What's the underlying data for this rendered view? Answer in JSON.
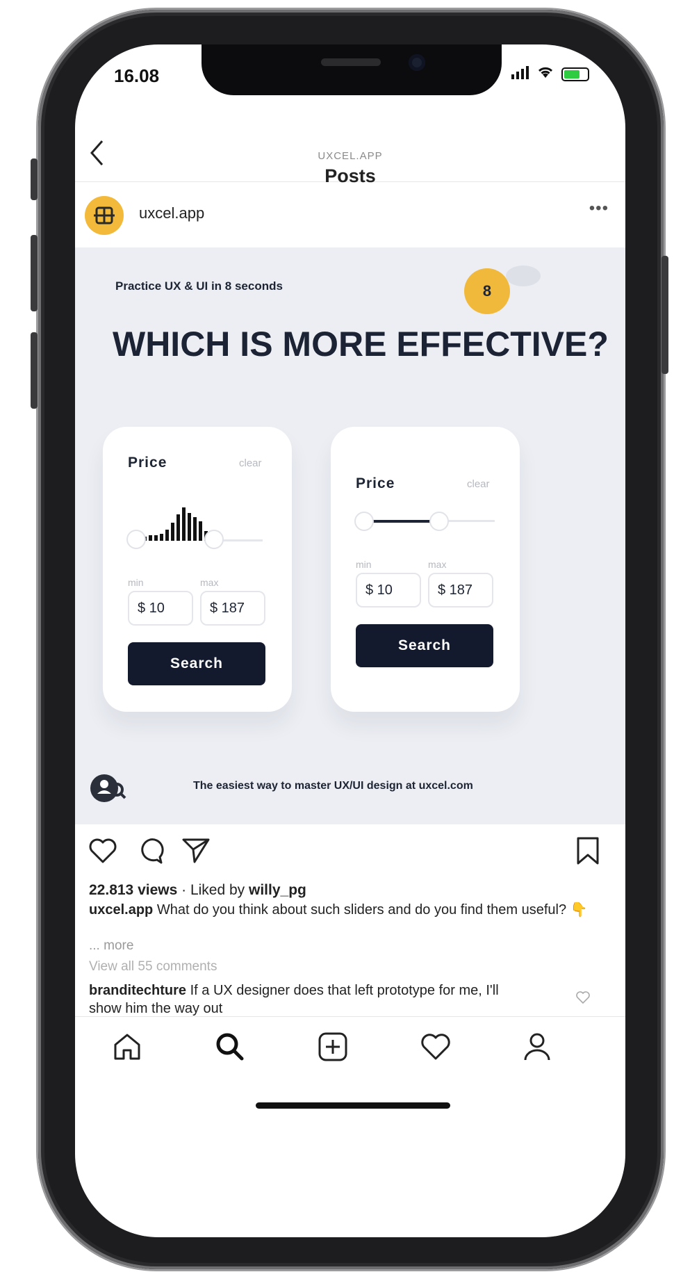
{
  "status_bar": {
    "time": "16.08"
  },
  "header": {
    "subtitle": "UXCEL.APP",
    "title": "Posts"
  },
  "post": {
    "username": "uxcel.app",
    "more_dots": "•••",
    "practice_label": "Practice UX & UI in 8 seconds",
    "timer": "8",
    "question": "WHICH IS MORE EFFECTIVE?",
    "cards": [
      {
        "price_label": "Price",
        "clear_label": "clear",
        "min_label": "min",
        "max_label": "max",
        "min_value": "$ 10",
        "max_value": "$ 187",
        "search_label": "Search"
      },
      {
        "price_label": "Price",
        "clear_label": "clear",
        "min_label": "min",
        "max_label": "max",
        "min_value": "$ 10",
        "max_value": "$ 187",
        "search_label": "Search"
      }
    ],
    "footer_text": "The easiest way to master UX/UI design at",
    "footer_link": "uxcel.com"
  },
  "engagement": {
    "views": "22.813 views",
    "liked_by_prefix": "· Liked by",
    "liked_by_user": "willy_pg",
    "caption_user": "uxcel.app",
    "caption_text": "What do you think about such sliders and do you find them useful? 👇",
    "more": "... more",
    "view_all": "View all 55 comments",
    "comment_user": "branditechture",
    "comment_text": "If a UX designer does that left prototype for me, I'll show him the way out"
  },
  "tabbar": {
    "items": [
      "home",
      "search",
      "add",
      "activity",
      "profile"
    ]
  },
  "colors": {
    "accent_yellow": "#f1b93c",
    "dark_navy": "#141a2e",
    "post_bg": "#eceef3"
  }
}
